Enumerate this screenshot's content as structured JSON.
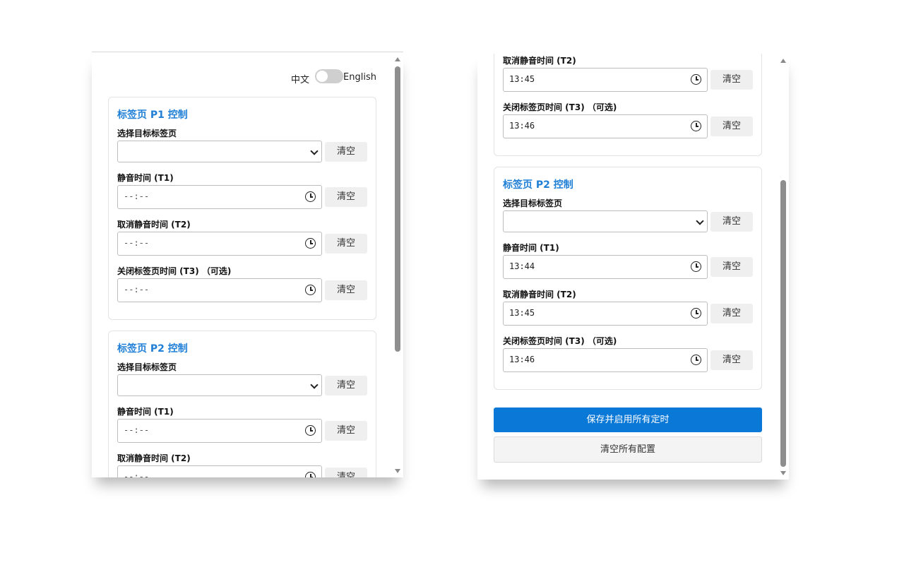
{
  "lang_toggle": {
    "zh_label": "中文",
    "en_label": "English",
    "enabled": false
  },
  "cards": [
    {
      "title": "标签页 P1 控制",
      "select_label": "选择目标标签页",
      "select_value": "",
      "t1_label": "静音时间 (T1)",
      "t2_label": "取消静音时间 (T2)",
      "t3_label": "关闭标签页时间 (T3) （可选)",
      "clear_label": "清空",
      "left_values": {
        "t1": "--:--",
        "t2": "--:--",
        "t3": "--:--"
      },
      "right_values": {
        "t2": "13:45",
        "t3": "13:46"
      }
    },
    {
      "title": "标签页 P2 控制",
      "select_label": "选择目标标签页",
      "select_value": "",
      "t1_label": "静音时间 (T1)",
      "t2_label": "取消静音时间 (T2)",
      "t3_label": "关闭标签页时间 (T3) （可选)",
      "clear_label": "清空",
      "left_values": {
        "t1": "--:--",
        "t2": "--:--"
      },
      "right_values": {
        "t1": "13:44",
        "t2": "13:45",
        "t3": "13:46"
      }
    }
  ],
  "actions": {
    "save_label": "保存并启用所有定时",
    "reset_label": "清空所有配置"
  },
  "colors": {
    "accent": "#0a78d7",
    "title": "#1f7fd6",
    "clear_bg": "#efefef",
    "toggle_off": "#cfcfcf"
  },
  "icons": {
    "time_picker": "clock-icon",
    "dropdown": "chevron-down-icon"
  }
}
